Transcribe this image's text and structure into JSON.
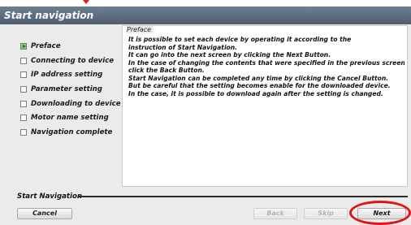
{
  "window": {
    "title": "Start navigation"
  },
  "steps": [
    {
      "label": "Preface",
      "active": true
    },
    {
      "label": "Connecting to device",
      "active": false
    },
    {
      "label": "IP address setting",
      "active": false
    },
    {
      "label": "Parameter setting",
      "active": false
    },
    {
      "label": "Downloading to device",
      "active": false
    },
    {
      "label": "Motor name setting",
      "active": false
    },
    {
      "label": "Navigation complete",
      "active": false
    }
  ],
  "preface": {
    "section_label": "Preface",
    "lines": [
      "It is possible to set each device by operating it according to the",
      "instruction of Start Navigation.",
      "It can go into the next screen by clicking the Next Button.",
      "In the case of changing the contents that were specified in the previous screen,",
      "click the Back Button.",
      "Start Navigation can be completed any time by clicking the Cancel Button.",
      "But be careful that the setting becomes enable for the downloaded device.",
      "In the case, it is possible to download again after the setting is changed."
    ]
  },
  "footer": {
    "label": "Start Navigation",
    "buttons": {
      "cancel": "Cancel",
      "back": "Back",
      "skip": "Skip",
      "next": "Next"
    }
  },
  "colors": {
    "titlebar": "#5b6b7e",
    "active_step": "#8fc98f",
    "highlight_annotation": "#e01414"
  }
}
